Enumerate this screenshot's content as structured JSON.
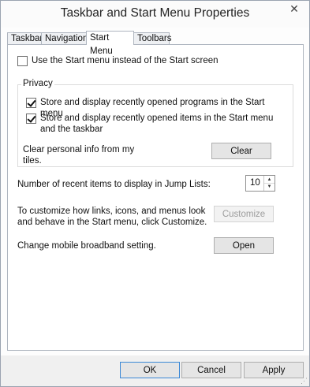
{
  "window": {
    "title": "Taskbar and Start Menu Properties",
    "close_glyph": "✕"
  },
  "tabs": [
    {
      "label": "Taskbar"
    },
    {
      "label": "Navigation"
    },
    {
      "label": "Start Menu",
      "active": true
    },
    {
      "label": "Toolbars"
    }
  ],
  "start_menu": {
    "use_start_menu": {
      "label": "Use the Start menu instead of the Start screen",
      "checked": false
    }
  },
  "privacy": {
    "title": "Privacy",
    "store_programs": {
      "label": "Store and display recently opened programs in the Start menu",
      "checked": true
    },
    "store_items": {
      "label": "Store and display recently opened items in the Start menu and the taskbar",
      "checked": true
    },
    "clear_text": "Clear personal info from my tiles.",
    "clear_button": "Clear"
  },
  "jump_lists": {
    "label": "Number of recent items to display in Jump Lists:",
    "value": "10"
  },
  "customize": {
    "text": "To customize how links, icons, and menus look and behave in the Start menu, click Customize.",
    "button": "Customize"
  },
  "broadband": {
    "text": "Change mobile broadband setting.",
    "button": "Open"
  },
  "footer": {
    "ok": "OK",
    "cancel": "Cancel",
    "apply": "Apply"
  }
}
